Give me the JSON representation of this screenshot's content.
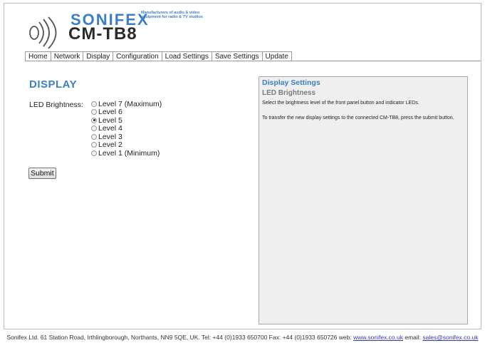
{
  "header": {
    "brand": "SONIFEX",
    "tagline": "Manufacturers of audio & video equipment for radio & TV studios",
    "model": "CM-TB8"
  },
  "nav": {
    "tabs": [
      {
        "label": "Home"
      },
      {
        "label": "Network"
      },
      {
        "label": "Display",
        "active": true
      },
      {
        "label": "Configuration"
      },
      {
        "label": "Load Settings"
      },
      {
        "label": "Save Settings"
      },
      {
        "label": "Update"
      }
    ]
  },
  "main": {
    "title": "DISPLAY",
    "led_label": "LED Brightness:",
    "options": [
      {
        "label": "Level 7 (Maximum)",
        "checked": false
      },
      {
        "label": "Level 6",
        "checked": false
      },
      {
        "label": "Level 5",
        "checked": true
      },
      {
        "label": "Level 4",
        "checked": false
      },
      {
        "label": "Level 3",
        "checked": false
      },
      {
        "label": "Level 2",
        "checked": false
      },
      {
        "label": "Level 1 (Minimum)",
        "checked": false
      }
    ],
    "submit_label": "Submit"
  },
  "help": {
    "title": "Display Settings",
    "subtitle": "LED Brightness",
    "p1": "Select the brightness level of the front panel button and indicator LEDs.",
    "p2": "To transfer the new display settings to the connected CM-TB8, press the submit button."
  },
  "footer": {
    "text": "Sonifex Ltd. 61 Station Road, Irthlingborough, Northants, NN9 5QE, UK. Tel: +44 (0)1933 650700 Fax: +44 (0)1933 650726 web: ",
    "web_link": "www.sonifex.co.uk",
    "email_label": " email: ",
    "email_link": "sales@sonifex.co.uk"
  },
  "colors": {
    "accent": "#3d7fc4",
    "panel_bg": "#efefef"
  }
}
